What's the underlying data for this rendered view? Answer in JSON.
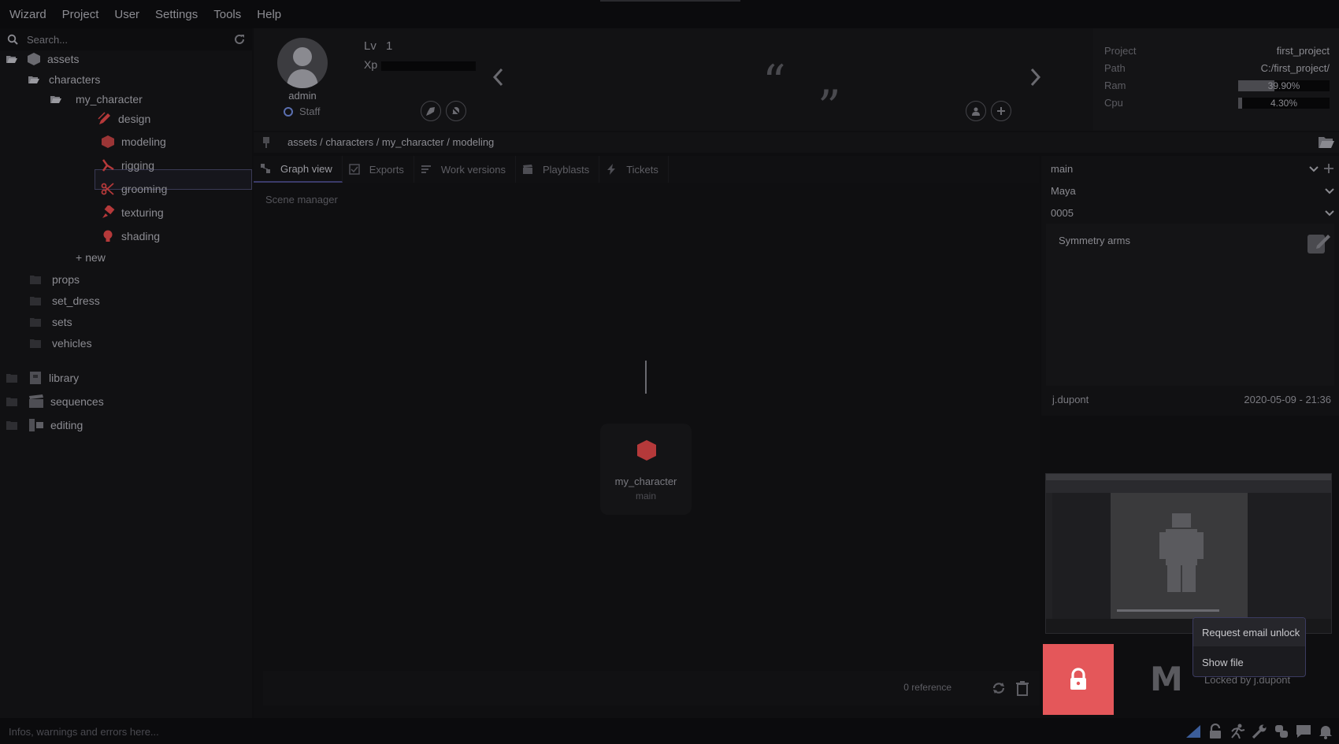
{
  "menu": [
    "Wizard",
    "Project",
    "User",
    "Settings",
    "Tools",
    "Help"
  ],
  "search": {
    "placeholder": "Search..."
  },
  "tree": {
    "assets": "assets",
    "characters": "characters",
    "my_character": "my_character",
    "stages": [
      "design",
      "modeling",
      "rigging",
      "grooming",
      "texturing",
      "shading"
    ],
    "new": "new",
    "subfolders": [
      "props",
      "set_dress",
      "sets",
      "vehicles"
    ],
    "roots": [
      "library",
      "sequences",
      "editing"
    ]
  },
  "user": {
    "name": "admin",
    "role": "Staff",
    "lv_label": "Lv",
    "lv": "1",
    "xp_label": "Xp",
    "xp_progress": 0
  },
  "project": {
    "project_label": "Project",
    "project": "first_project",
    "path_label": "Path",
    "path": "C:/first_project/",
    "ram_label": "Ram",
    "ram": "39.90%",
    "ram_value": 39.9,
    "cpu_label": "Cpu",
    "cpu": "4.30%",
    "cpu_value": 4.3
  },
  "breadcrumb": "assets / characters / my_character / modeling",
  "tabs": [
    "Graph view",
    "Exports",
    "Work versions",
    "Playblasts",
    "Tickets"
  ],
  "graph": {
    "title": "Scene manager",
    "node_name": "my_character",
    "node_branch": "main",
    "references": "0 reference"
  },
  "version_panel": {
    "variant": "main",
    "software": "Maya",
    "version": "0005",
    "comment": "Symmetry arms",
    "user": "j.dupont",
    "date": "2020-05-09 - 21:36"
  },
  "lock": {
    "logo": "M",
    "locked_by": "Locked by j.dupont"
  },
  "context_menu": [
    "Request email unlock",
    "Show file"
  ],
  "status": {
    "message": "Infos, warnings and errors here..."
  },
  "colors": {
    "accent": "#3b3b6a",
    "lock": "#e4575a",
    "stage": "#c0392b"
  }
}
